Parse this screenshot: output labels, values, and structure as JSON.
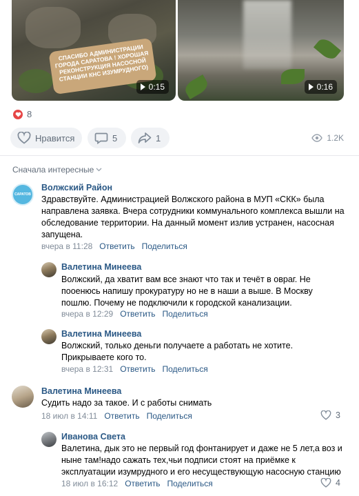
{
  "videos": [
    {
      "sticker_text": "СПАСИБО АДМИНИСТРАЦИИ ГОРОДА САРАТОВА ! ХОРОШАЯ РЕКОНСТРУКЦИЯ НАСОСНОЙ СТАНЦИИ КНС ИЗУМРУДНОГО)",
      "duration": "0:15"
    },
    {
      "duration": "0:16"
    }
  ],
  "reactions": {
    "count": "8",
    "icon": "heart-icon",
    "color": "#e64646"
  },
  "actions": {
    "like_label": "Нравится",
    "comments_count": "5",
    "shares_count": "1",
    "views_count": "1.2K"
  },
  "sort": {
    "label": "Сначала интересные"
  },
  "comments": [
    {
      "author": "Волжский Район",
      "avatar_text": "САРАТОВ",
      "text": "Здравствуйте. Администрацией Волжского района в МУП «СКК» была направлена заявка. Вчера сотрудники коммунального комплекса вышли на обследование территории. На данный момент излив устранен, насосная запущена.",
      "time": "вчера в 11:28",
      "reply_label": "Ответить",
      "share_label": "Поделиться",
      "replies": [
        {
          "author": "Валетина Минеева",
          "text": "Волжский, да хватит вам все знают что так и течёт в овраг. Не пооенюсь напишу прокуратуру но не в наши а выше. В Москву пошлю. Почему не подключили к городской канализации.",
          "time": "вчера в 12:29",
          "reply_label": "Ответить",
          "share_label": "Поделиться"
        },
        {
          "author": "Валетина Минеева",
          "text": "Волжский, только деньги получаете а работать не хотите. Прикрываете кого то.",
          "time": "вчера в 12:31",
          "reply_label": "Ответить",
          "share_label": "Поделиться"
        }
      ]
    },
    {
      "author": "Валетина Минеева",
      "text": "Судить надо за такое. И с работы снимать",
      "time": "18 июл в 14:11",
      "reply_label": "Ответить",
      "share_label": "Поделиться",
      "likes": "3",
      "replies": [
        {
          "author": "Иванова Света",
          "text": "Валетина, дык это не первый год фонтанирует и даже не 5 лет,а воз и ныне там!надо сажать тех,чьи подписи стоят на приёмке к эксплуатации изумрудного и его несуществующую насосную станцию",
          "time": "18 июл в 16:12",
          "reply_label": "Ответить",
          "share_label": "Поделиться",
          "likes": "4"
        }
      ]
    }
  ],
  "colors": {
    "link": "#2a5885",
    "muted": "#818c99",
    "pill_bg": "#f0f2f5"
  }
}
